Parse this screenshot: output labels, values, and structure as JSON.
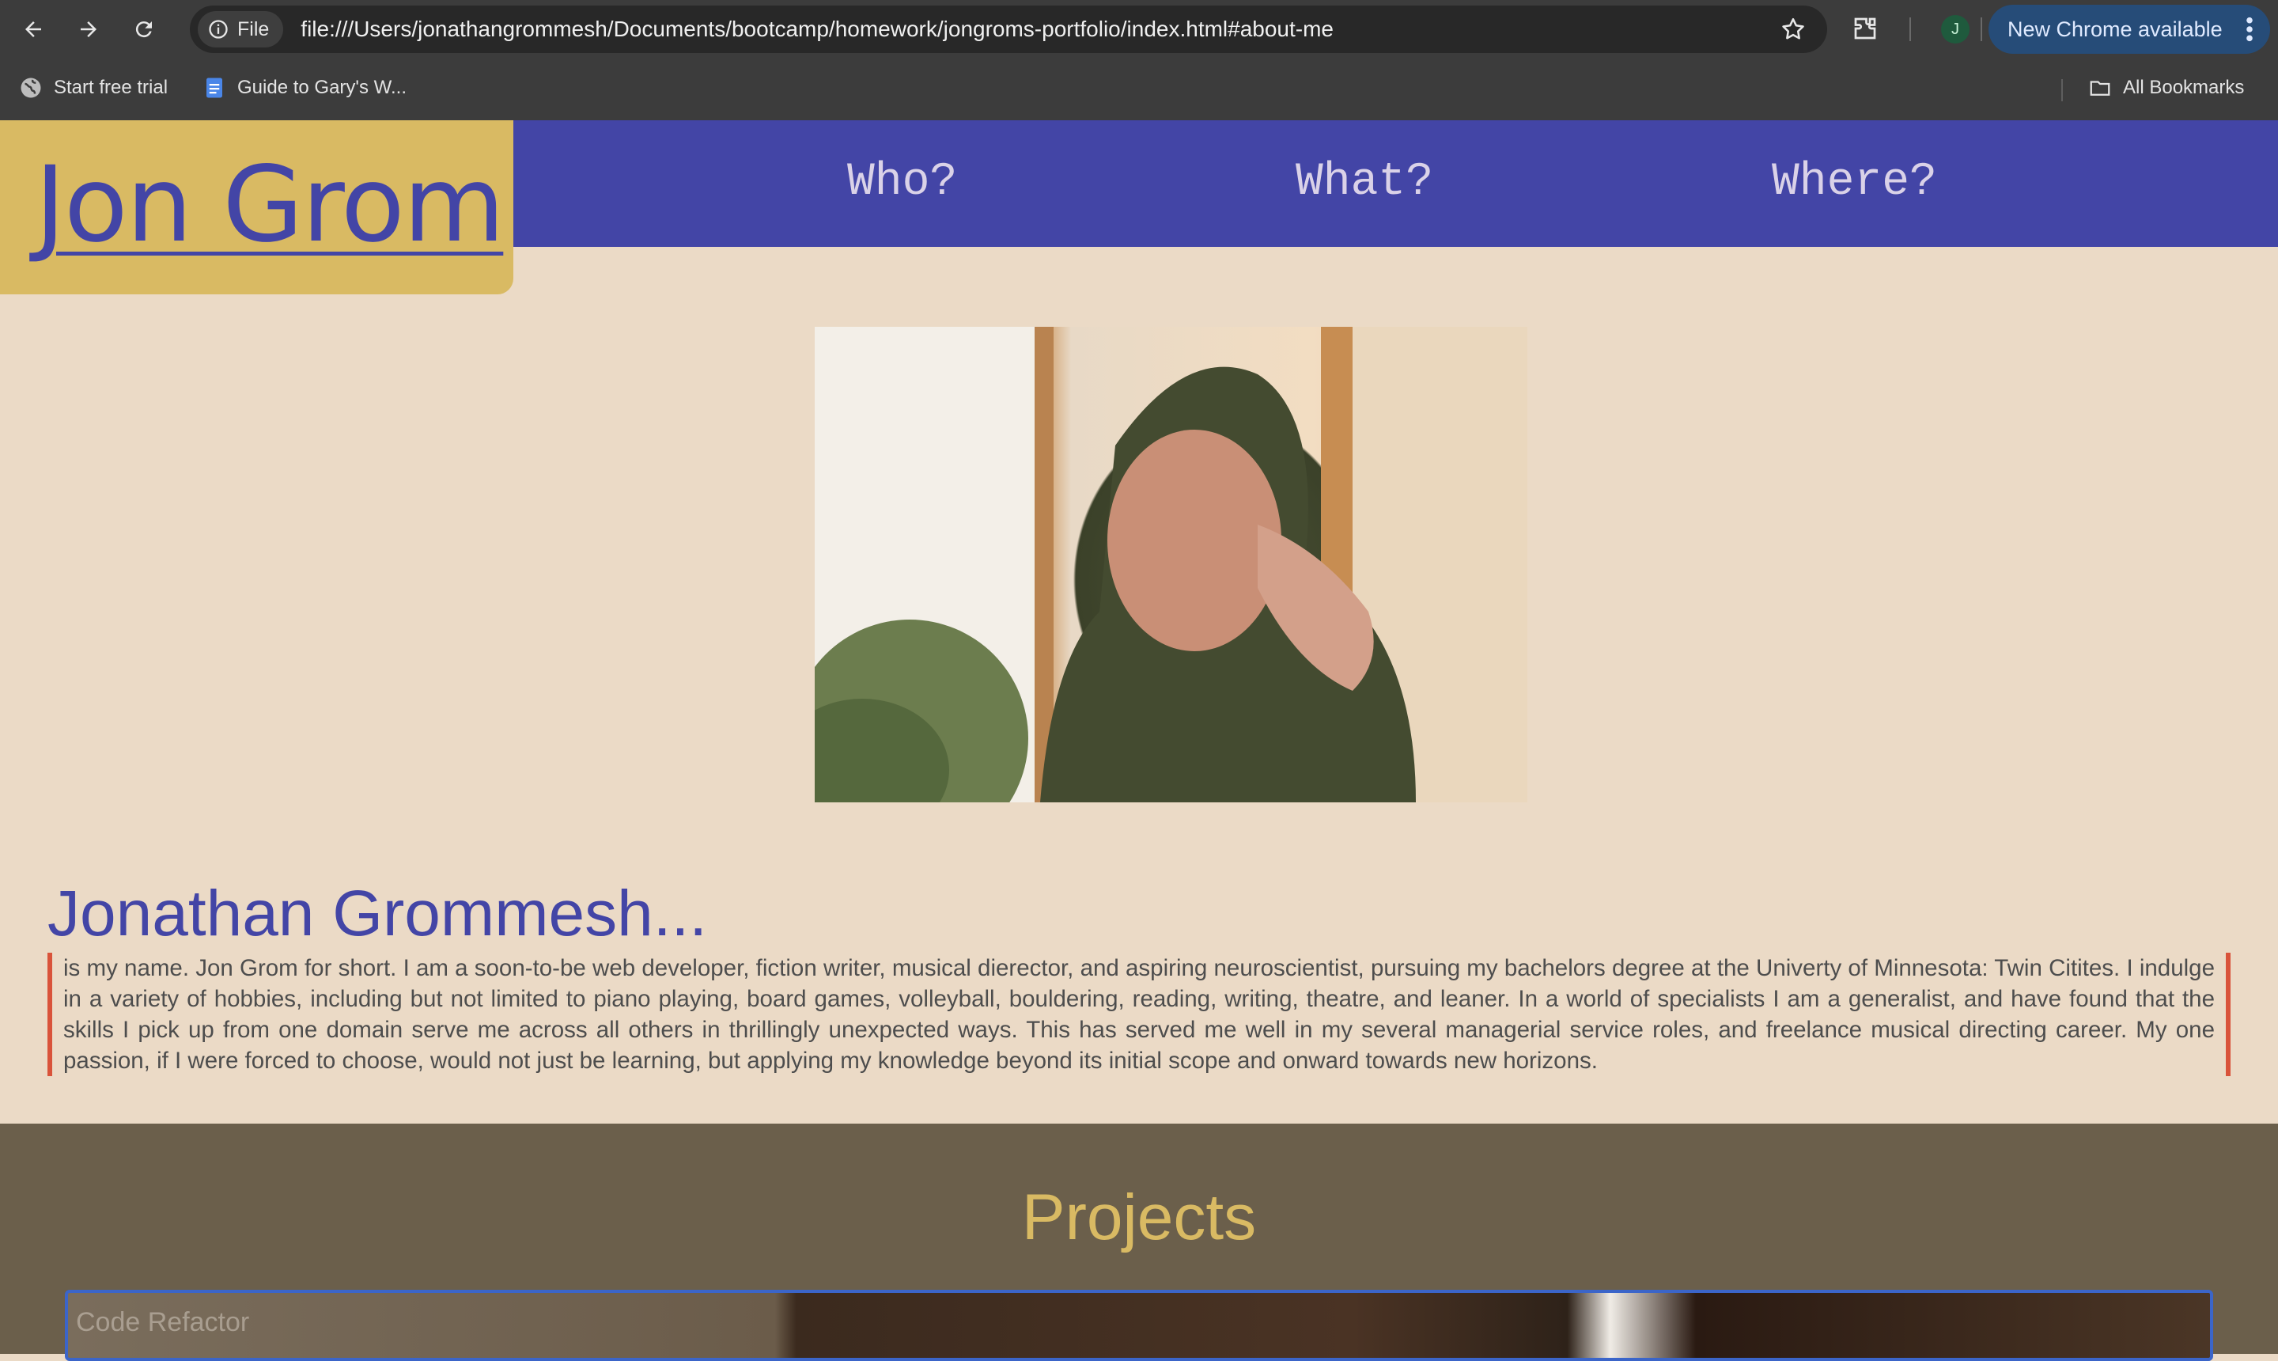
{
  "browser": {
    "url": "file:///Users/jonathangrommesh/Documents/bootcamp/homework/jongroms-portfolio/index.html#about-me",
    "scheme_chip": "File",
    "profile_initial": "J",
    "update_button": "New Chrome available",
    "bookmarks": [
      {
        "label": "Start free trial",
        "icon": "globe-icon"
      },
      {
        "label": "Guide to Gary's W...",
        "icon": "docs-icon"
      }
    ],
    "all_bookmarks": "All Bookmarks"
  },
  "site": {
    "brand": "Jon Grom",
    "nav": [
      "Who?",
      "What?",
      "Where?"
    ],
    "about_title": "Jonathan Grommesh...",
    "about_text": "is my name. Jon Grom for short. I am a soon-to-be web developer, fiction writer, musical dierector, and aspiring neuroscientist, pursuing my bachelors degree at the Univerty of Minnesota: Twin Citites. I indulge in a variety of hobbies, including but not limited to piano playing, board games, volleyball, bouldering, reading, writing, theatre, and leaner. In a world of specialists I am a generalist, and have found that the skills I pick up from one domain serve me across all others in thrillingly unexpected ways. This has served me well in my several managerial service roles, and freelance musical directing career. My one passion, if I were forced to choose, would not just be learning, but applying my knowledge beyond its initial scope and onward towards new horizons.",
    "projects_title": "Projects",
    "project_card_label": "Code Refactor"
  },
  "colors": {
    "nav_bg": "#4345a6",
    "brand_bg": "#d9ba63",
    "page_bg": "#ebdac6",
    "accent_border": "#d9533a",
    "projects_bg": "#6b5f4b"
  }
}
